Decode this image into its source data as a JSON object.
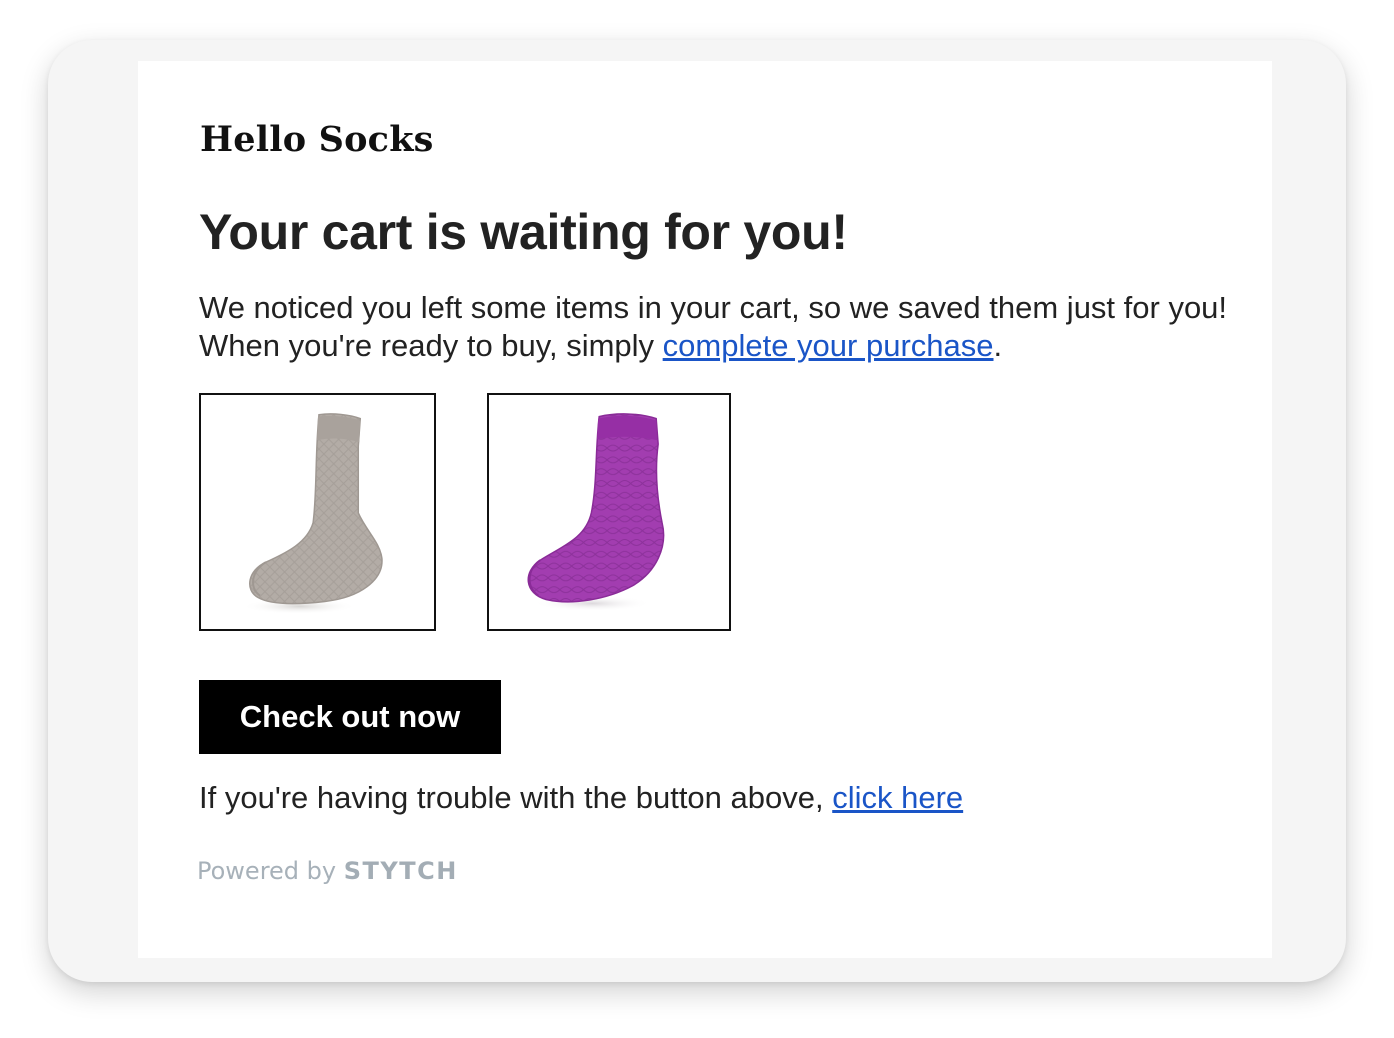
{
  "brand": {
    "name": "Hello Socks"
  },
  "email": {
    "headline": "Your cart is waiting for you!",
    "body_before_link": "We noticed you left some items in your cart, so we saved them just for you! When you're ready to buy, simply ",
    "body_link": "complete your purchase",
    "body_after_link": ".",
    "products": [
      {
        "name": "grey-knit-sock",
        "color": "#b3aca6"
      },
      {
        "name": "purple-knit-sock",
        "color": "#a23db0"
      }
    ],
    "cta_label": "Check out now",
    "trouble_text": "If you're having trouble with the button above, ",
    "trouble_link": "click here"
  },
  "footer": {
    "powered_by": "Powered by",
    "logo_text": "STYTCH"
  },
  "colors": {
    "link": "#1a55c7",
    "button_bg": "#000000",
    "frame_bg": "#f5f5f5",
    "footer_text": "#a7b1b9"
  }
}
